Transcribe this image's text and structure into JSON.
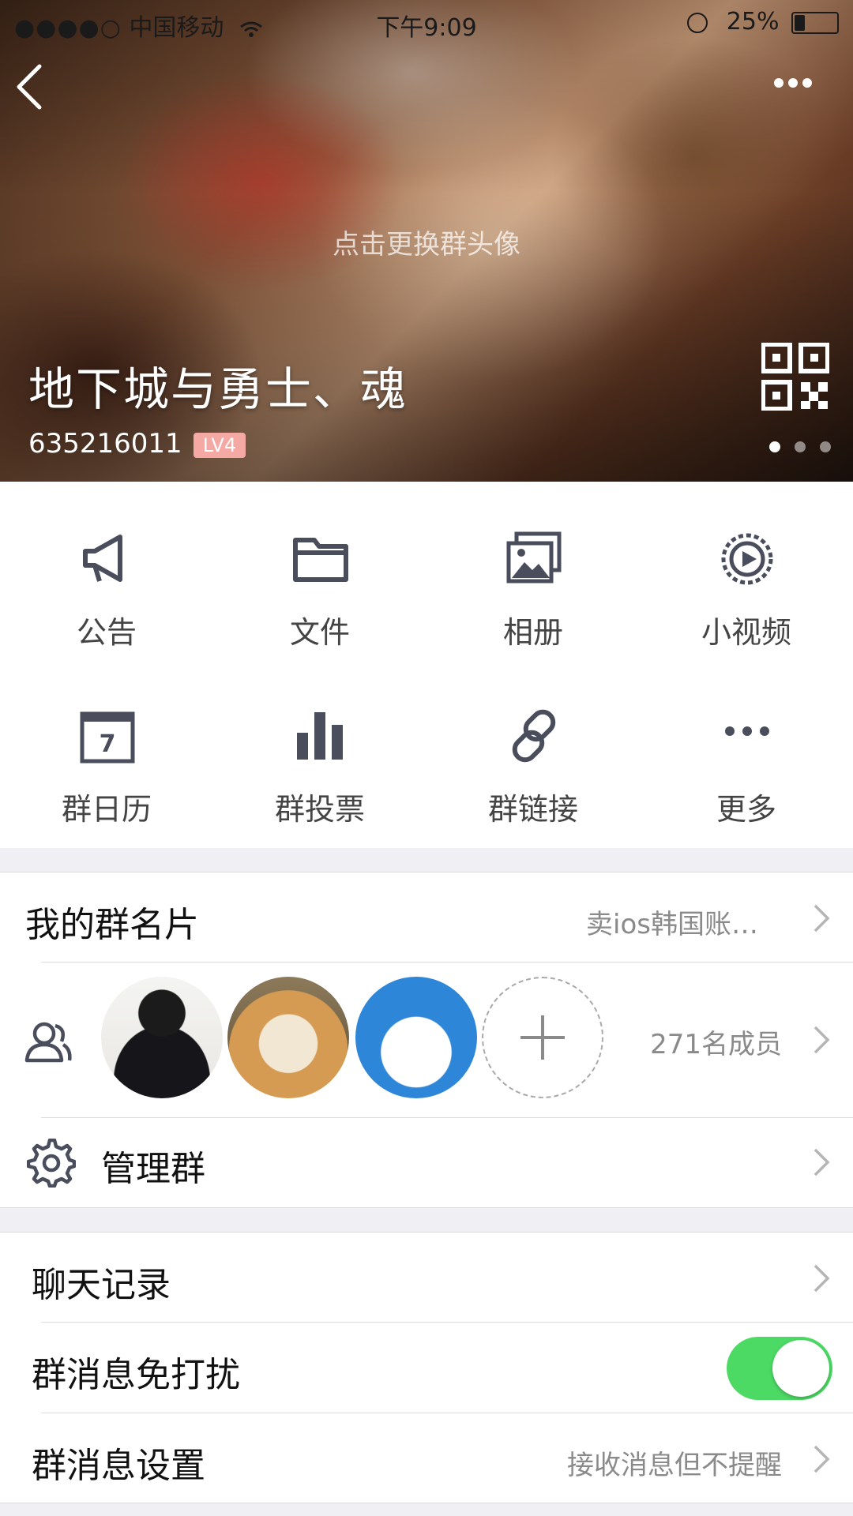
{
  "status_bar": {
    "signal_dots": "●●●●○",
    "carrier": "中国移动",
    "time": "下午9:09",
    "battery": "25%",
    "battery_level": 0.25
  },
  "header": {
    "change_avatar_hint": "点击更换群头像",
    "group_name": "地下城与勇士、魂",
    "group_id": "635216011",
    "level_badge": "LV4",
    "icons": {
      "back": "chevron-left-icon",
      "more": "more-horizontal-icon",
      "qr": "qr-code-icon"
    }
  },
  "features": [
    {
      "label": "公告",
      "icon": "megaphone-icon"
    },
    {
      "label": "文件",
      "icon": "folder-icon"
    },
    {
      "label": "相册",
      "icon": "photo-album-icon"
    },
    {
      "label": "小视频",
      "icon": "video-icon"
    },
    {
      "label": "群日历",
      "icon": "calendar-icon"
    },
    {
      "label": "群投票",
      "icon": "bar-chart-icon"
    },
    {
      "label": "群链接",
      "icon": "link-icon"
    },
    {
      "label": "更多",
      "icon": "more-horizontal-icon"
    }
  ],
  "calendar_day": "7",
  "settings_1": {
    "card_label": "我的群名片",
    "card_value": "卖ios韩国账…",
    "member_count": "271名成员",
    "manage_label": "管理群"
  },
  "settings_2": {
    "chat_history": "聊天记录",
    "mute_label": "群消息免打扰",
    "mute_on": true,
    "notify_label": "群消息设置",
    "notify_value": "接收消息但不提醒"
  },
  "colors": {
    "accent_green": "#4cd964",
    "icon_gray": "#4a4d5c",
    "level_badge": "#f4a9a5"
  }
}
